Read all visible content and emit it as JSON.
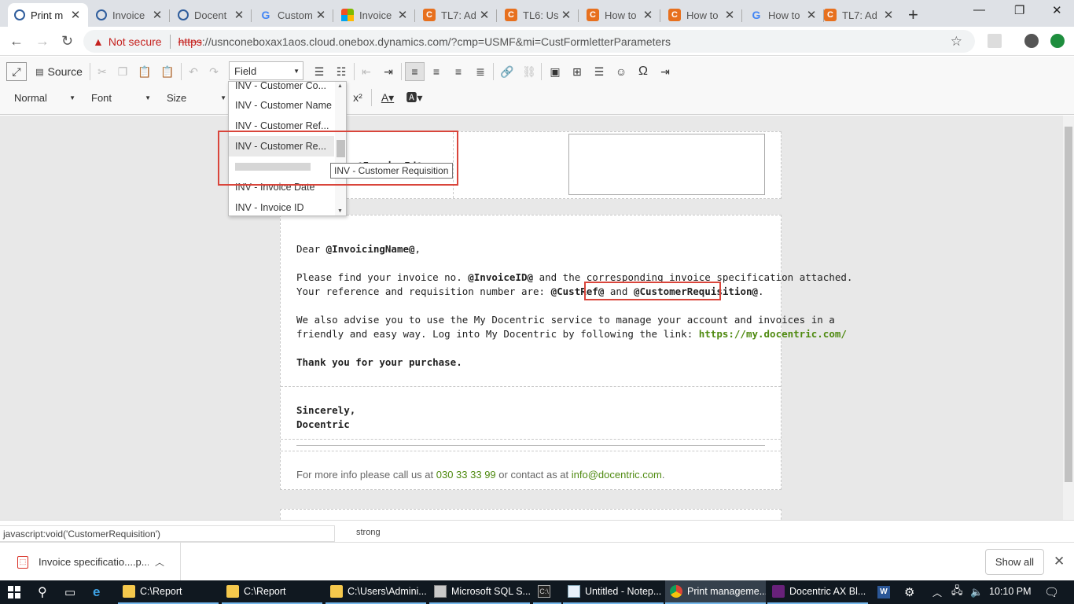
{
  "browser": {
    "tabs": [
      {
        "label": "Print m",
        "icon": "chart-favicon",
        "active": true
      },
      {
        "label": "Invoice",
        "icon": "chart-favicon",
        "active": false
      },
      {
        "label": "Docent",
        "icon": "chart-favicon",
        "active": false
      },
      {
        "label": "Custom",
        "icon": "google-favicon",
        "active": false
      },
      {
        "label": "Invoice",
        "icon": "microsoft-favicon",
        "active": false
      },
      {
        "label": "TL7: Ad",
        "icon": "orange-favicon",
        "active": false
      },
      {
        "label": "TL6: Us",
        "icon": "orange-favicon",
        "active": false
      },
      {
        "label": "How to",
        "icon": "orange-favicon",
        "active": false
      },
      {
        "label": "How to",
        "icon": "orange-favicon",
        "active": false
      },
      {
        "label": "How to",
        "icon": "google-favicon",
        "active": false
      },
      {
        "label": "TL7: Ad",
        "icon": "orange-favicon",
        "active": false
      }
    ],
    "new_tab": "+",
    "close_glyph": "✕",
    "security_label": "Not secure",
    "url_scheme": "https",
    "url_rest": "://usnconeboxax1aos.cloud.onebox.dynamics.com/?cmp=USMF&mi=CustFormletterParameters"
  },
  "editor": {
    "toolbar": {
      "source_label": "Source",
      "field_combo": "Field",
      "format_combo": "Normal",
      "font_combo": "Font",
      "size_combo": "Size",
      "superscript": "x²"
    },
    "field_dropdown": {
      "items": [
        "INV - Customer Co...",
        "INV - Customer Name",
        "INV - Customer Ref...",
        "INV - Customer Re...",
        "",
        "INV - Invoice Date",
        "INV - Invoice ID"
      ],
      "highlighted_index": 3,
      "tooltip": "INV - Customer Requisition"
    },
    "document": {
      "header_field_partial": ". @InvoiceId@",
      "greeting_prefix": "Dear ",
      "greeting_field": "@InvoicingName@",
      "greeting_suffix": ",",
      "line1_prefix": "Please find your invoice no. ",
      "line1_field": "@InvoiceID@",
      "line1_suffix": " and the corresponding invoice specification attached.",
      "line2_prefix": "Your reference and requisition number are: ",
      "line2_field1": "@CustRef@",
      "line2_mid": " and ",
      "line2_field2": "@CustomerRequisition@",
      "line2_suffix": ".",
      "line3": "We also advise you to use the My Docentric service to manage your account and invoices in a",
      "line4_prefix": "friendly and easy way. Log into My Docentric by following the link: ",
      "line4_link": "https://my.docentric.com/",
      "thanks": "Thank you for your purchase.",
      "sincerely": "Sincerely,",
      "signature": "Docentric",
      "footer_prefix": "For more info please call us at ",
      "footer_phone": "030 33 33 99",
      "footer_mid": " or contact as at ",
      "footer_email": "info@docentric.com",
      "footer_suffix": "."
    },
    "elements_path": "strong"
  },
  "status_url": "javascript:void('CustomerRequisition')",
  "downloads": {
    "file_name": "Invoice specificatio....p...",
    "show_all": "Show all"
  },
  "taskbar": {
    "items": [
      {
        "label": "C:\\Report",
        "icon": "folder-icon"
      },
      {
        "label": "C:\\Report",
        "icon": "folder-icon"
      },
      {
        "label": "C:\\Users\\Admini...",
        "icon": "folder-icon"
      },
      {
        "label": "Microsoft SQL S...",
        "icon": "sql-icon"
      },
      {
        "label": "",
        "icon": "cmd-icon"
      },
      {
        "label": "Untitled - Notep...",
        "icon": "notepad-icon"
      },
      {
        "label": "Print manageme...",
        "icon": "chrome-icon"
      },
      {
        "label": "Docentric AX Bl...",
        "icon": "visual-studio-icon"
      }
    ],
    "clock": "10:10 PM"
  }
}
